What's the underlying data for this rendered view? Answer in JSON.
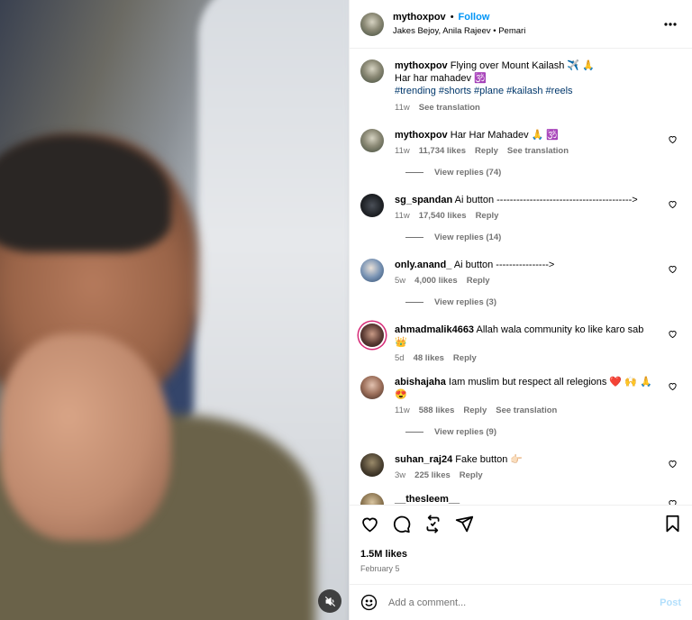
{
  "colors": {
    "accent": "#0095f6",
    "hashtag": "#00376b",
    "muted": "#737373"
  },
  "header": {
    "username": "mythoxpov",
    "separator": "•",
    "follow_label": "Follow",
    "subline": "Jakes Bejoy, Anila Rajeev • Pemari"
  },
  "caption": {
    "username": "mythoxpov",
    "text": "Flying over Mount Kailash ✈️ 🙏",
    "line2": "Har har mahadev 🕉️",
    "hashtags": "#trending #shorts #plane #kailash #reels",
    "time": "11w",
    "translate": "See translation"
  },
  "comments": [
    {
      "username": "mythoxpov",
      "text": "Har Har Mahadev 🙏 🕉️",
      "time": "11w",
      "likes": "11,734 likes",
      "reply": "Reply",
      "translate": "See translation",
      "view_replies": "View replies (74)"
    },
    {
      "username": "sg_spandan",
      "text": "Ai button ----------------------------------------->",
      "time": "11w",
      "likes": "17,540 likes",
      "reply": "Reply",
      "view_replies": "View replies (14)"
    },
    {
      "username": "only.anand_",
      "text": "Ai button ---------------->",
      "time": "5w",
      "likes": "4,000 likes",
      "reply": "Reply",
      "view_replies": "View replies (3)"
    },
    {
      "username": "ahmadmalik4663",
      "text": "Allah wala community ko like karo sab 👑",
      "time": "5d",
      "likes": "48 likes",
      "reply": "Reply"
    },
    {
      "username": "abishajaha",
      "text": "Iam muslim but respect all relegions ❤️ 🙌 🙏 😍",
      "time": "11w",
      "likes": "588 likes",
      "reply": "Reply",
      "translate": "See translation",
      "view_replies": "View replies (9)"
    },
    {
      "username": "suhan_raj24",
      "text": "Fake button 👉🏻",
      "time": "3w",
      "likes": "225 likes",
      "reply": "Reply"
    },
    {
      "username": "__thesleem__",
      "text": ""
    }
  ],
  "footer": {
    "likes": "1.5M likes",
    "date": "February 5",
    "comment_placeholder": "Add a comment...",
    "post_label": "Post"
  }
}
